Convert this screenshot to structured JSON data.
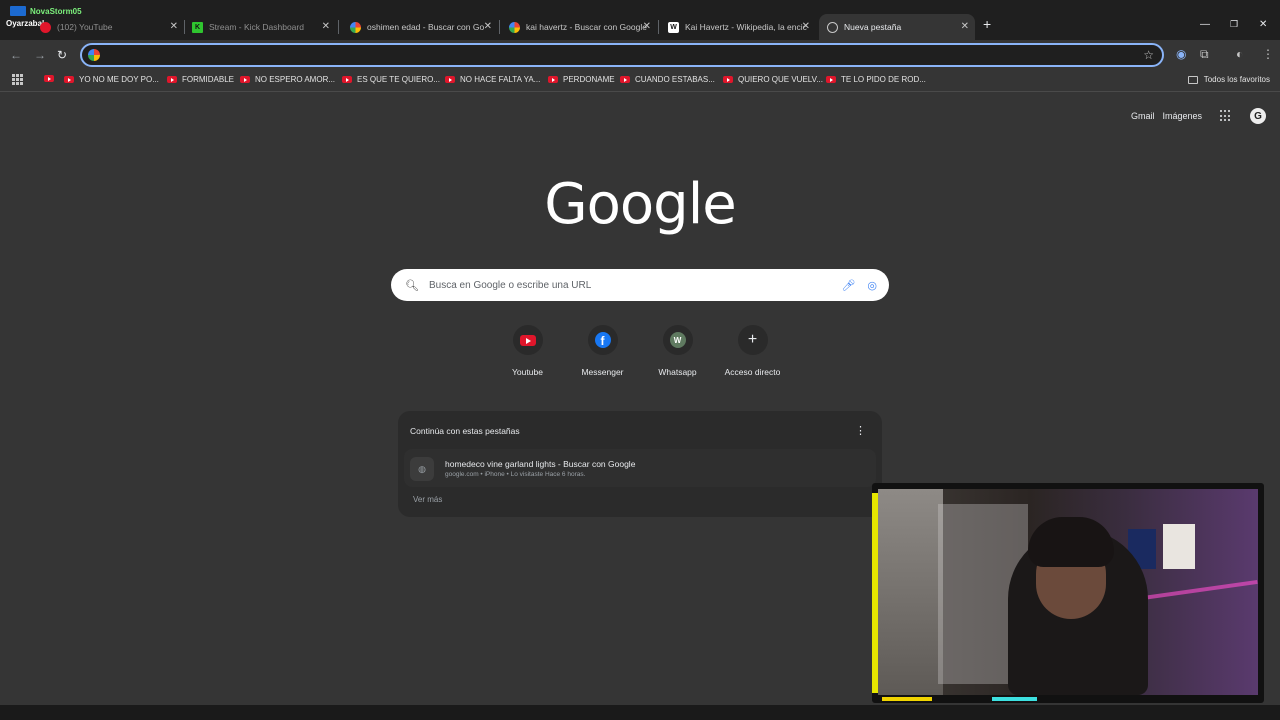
{
  "overlay": {
    "channel": "NovaStorm05",
    "subtitle": "Oyarzabal"
  },
  "tabs": [
    {
      "title": "(102) YouTube"
    },
    {
      "title": "Stream - Kick Dashboard"
    },
    {
      "title": "oshimen edad - Buscar con Go"
    },
    {
      "title": "kai havertz - Buscar con Google"
    },
    {
      "title": "Kai Havertz - Wikipedia, la encic"
    },
    {
      "title": "Nueva pestaña"
    }
  ],
  "omnibox": {
    "value": "",
    "placeholder": ""
  },
  "bookmarks": [
    "YO NO ME DOY PO...",
    "FORMIDABLE",
    "NO ESPERO AMOR...",
    "ES QUE TE QUIERO...",
    "NO HACE FALTA YA...",
    "PERDONAME",
    "CUANDO ESTABAS...",
    "QUIERO QUE VUELV...",
    "TE LO PIDO DE ROD..."
  ],
  "all_favorites": "Todos los favoritos",
  "toplinks": {
    "gmail": "Gmail",
    "images": "Imágenes",
    "avatar": "G"
  },
  "logo": "Google",
  "search": {
    "placeholder": "Busca en Google o escribe una URL"
  },
  "shortcuts": [
    {
      "label": "Youtube",
      "icon": "youtube-icon"
    },
    {
      "label": "Messenger",
      "icon": "facebook-icon"
    },
    {
      "label": "Whatsapp",
      "icon": "w-letter-icon",
      "letter": "W"
    },
    {
      "label": "Acceso directo",
      "icon": "plus-icon"
    }
  ],
  "continue": {
    "title": "Continúa con estas pestañas",
    "item_title": "homedeco vine garland lights - Buscar con Google",
    "item_meta": "google.com • iPhone • Lo visitaste Hace 6 horas.",
    "more": "Ver más"
  }
}
